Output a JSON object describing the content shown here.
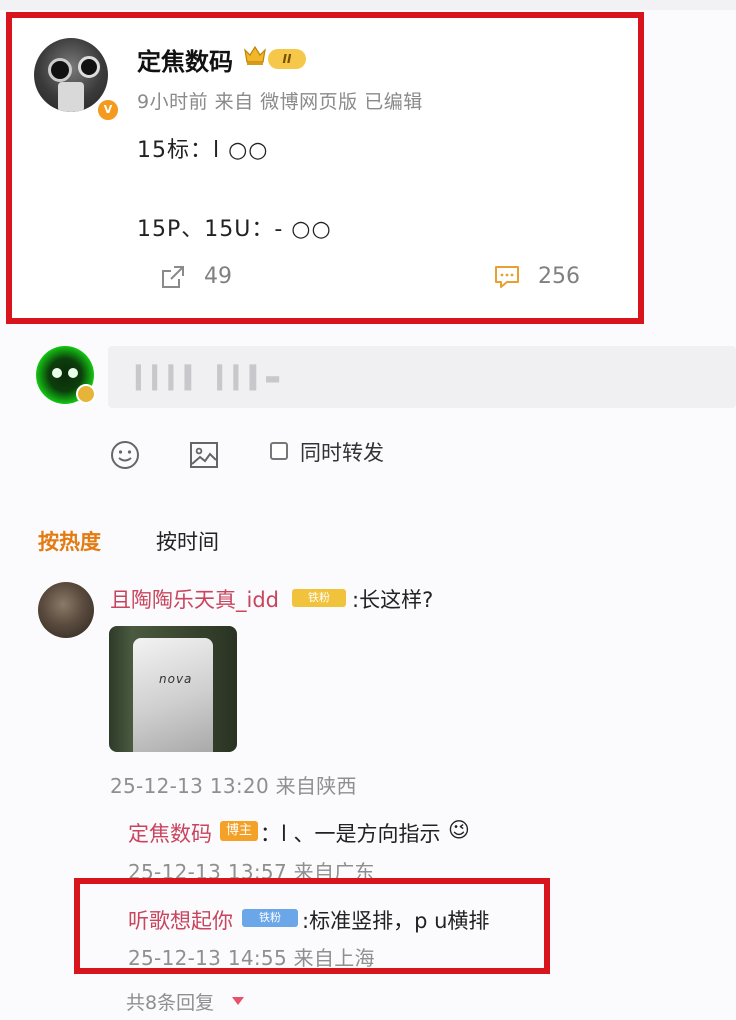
{
  "post": {
    "author": "定焦数码",
    "level": "II",
    "verified_badge": "V",
    "meta": "9小时前  来自  微博网页版  已编辑",
    "line1": "15标：l ○○",
    "line2": "15P、15U：- ○○",
    "share_count": "49",
    "comment_count": "256"
  },
  "composer": {
    "placeholder_bars": "▍▍▍▌ ▍▍▌▬",
    "repost_label": "同时转发",
    "emoji_icon": "smiley-icon",
    "image_icon": "image-icon"
  },
  "sort": {
    "hot": "按热度",
    "time": "按时间"
  },
  "comment": {
    "user": "且陶陶乐天真_idd",
    "badge": "铁粉",
    "text": ":长这样?",
    "image_label": "nova",
    "time": "25-12-13 13:20  来自陕西"
  },
  "replies": [
    {
      "user": "定焦数码",
      "badge": "博主",
      "text": "：l 、一是方向指示",
      "emoji": "😉",
      "time": "25-12-13 13:57  来自广东"
    },
    {
      "user": "听歌想起你",
      "badge": "铁粉",
      "text": ":标准竖排，p u横排",
      "time": "25-12-13 14:55  来自上海"
    }
  ],
  "more_replies": "共8条回复",
  "colors": {
    "highlight": "#d8141c",
    "accent_orange": "#e27c12",
    "username_pink": "#c9455e"
  }
}
